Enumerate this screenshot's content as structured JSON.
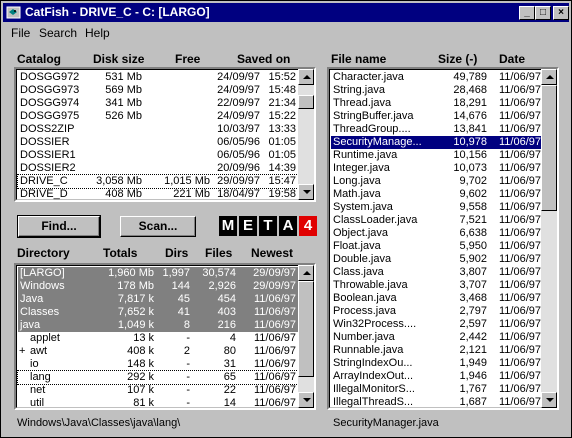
{
  "window": {
    "title": "CatFish - DRIVE_C - C: [LARGO]",
    "buttons": {
      "minimize": "_",
      "maximize": "□",
      "close": "×"
    }
  },
  "menubar": [
    "File",
    "Search",
    "Help"
  ],
  "catalog": {
    "headers": {
      "catalog": "Catalog",
      "disk_size": "Disk size",
      "free": "Free",
      "saved_on": "Saved on"
    },
    "rows": [
      {
        "name": "DOSGG972",
        "size": "531 Mb",
        "free": "",
        "date": "24/09/97",
        "time": "15:52"
      },
      {
        "name": "DOSGG973",
        "size": "569 Mb",
        "free": "",
        "date": "24/09/97",
        "time": "15:48"
      },
      {
        "name": "DOSGG974",
        "size": "341 Mb",
        "free": "",
        "date": "22/09/97",
        "time": "21:34"
      },
      {
        "name": "DOSGG975",
        "size": "526 Mb",
        "free": "",
        "date": "24/09/97",
        "time": "15:22"
      },
      {
        "name": "DOSS2ZIP",
        "size": "",
        "free": "",
        "date": "10/03/97",
        "time": "13:33"
      },
      {
        "name": "DOSSIER",
        "size": "",
        "free": "",
        "date": "06/05/96",
        "time": "01:05"
      },
      {
        "name": "DOSSIER1",
        "size": "",
        "free": "",
        "date": "06/05/96",
        "time": "01:05"
      },
      {
        "name": "DOSSIER2",
        "size": "",
        "free": "",
        "date": "20/09/96",
        "time": "14:39"
      },
      {
        "name": "DRIVE_C",
        "size": "3,058 Mb",
        "free": "1,015 Mb",
        "date": "29/09/97",
        "time": "15:47"
      },
      {
        "name": "DRIVE_D",
        "size": "408 Mb",
        "free": "221 Mb",
        "date": "18/04/97",
        "time": "19:58"
      }
    ],
    "focused_index": 8
  },
  "buttons": {
    "find": "Find...",
    "scan": "Scan..."
  },
  "logo": [
    "M",
    "E",
    "T",
    "A",
    "4"
  ],
  "directory": {
    "headers": {
      "directory": "Directory",
      "totals": "Totals",
      "dirs": "Dirs",
      "files": "Files",
      "newest": "Newest"
    },
    "rows": [
      {
        "name": "[LARGO]",
        "indent": 0,
        "prefix": "",
        "totals": "1,960 Mb",
        "dirs": "1,997",
        "files": "30,574",
        "newest": "29/09/97",
        "selected": true
      },
      {
        "name": "Windows",
        "indent": 0,
        "prefix": "",
        "totals": "178 Mb",
        "dirs": "144",
        "files": "2,926",
        "newest": "29/09/97",
        "selected": true
      },
      {
        "name": "Java",
        "indent": 0,
        "prefix": "",
        "totals": "7,817 k",
        "dirs": "45",
        "files": "454",
        "newest": "11/06/97",
        "selected": true
      },
      {
        "name": "Classes",
        "indent": 0,
        "prefix": "",
        "totals": "7,652 k",
        "dirs": "41",
        "files": "403",
        "newest": "11/06/97",
        "selected": true
      },
      {
        "name": "java",
        "indent": 0,
        "prefix": "",
        "totals": "1,049 k",
        "dirs": "8",
        "files": "216",
        "newest": "11/06/97",
        "selected": true
      },
      {
        "name": "applet",
        "indent": 1,
        "prefix": "",
        "totals": "13 k",
        "dirs": "-",
        "files": "4",
        "newest": "11/06/97",
        "selected": false
      },
      {
        "name": "awt",
        "indent": 1,
        "prefix": "+",
        "totals": "408 k",
        "dirs": "2",
        "files": "80",
        "newest": "11/06/97",
        "selected": false
      },
      {
        "name": "io",
        "indent": 1,
        "prefix": "",
        "totals": "148 k",
        "dirs": "-",
        "files": "31",
        "newest": "11/06/97",
        "selected": false
      },
      {
        "name": "lang",
        "indent": 1,
        "prefix": "",
        "totals": "292 k",
        "dirs": "-",
        "files": "65",
        "newest": "11/06/97",
        "selected": false
      },
      {
        "name": "net",
        "indent": 1,
        "prefix": "",
        "totals": "107 k",
        "dirs": "-",
        "files": "22",
        "newest": "11/06/97",
        "selected": false
      },
      {
        "name": "util",
        "indent": 1,
        "prefix": "",
        "totals": "81 k",
        "dirs": "-",
        "files": "14",
        "newest": "11/06/97",
        "selected": false
      }
    ],
    "focused_index": 8
  },
  "files": {
    "headers": {
      "name": "File name",
      "size": "Size (-)",
      "date": "Date"
    },
    "rows": [
      {
        "name": "Character.java",
        "size": "49,789",
        "date": "11/06/97"
      },
      {
        "name": "String.java",
        "size": "28,468",
        "date": "11/06/97"
      },
      {
        "name": "Thread.java",
        "size": "18,291",
        "date": "11/06/97"
      },
      {
        "name": "StringBuffer.java",
        "size": "14,676",
        "date": "11/06/97"
      },
      {
        "name": "ThreadGroup....",
        "size": "13,841",
        "date": "11/06/97"
      },
      {
        "name": "SecurityManage...",
        "size": "10,978",
        "date": "11/06/97"
      },
      {
        "name": "Runtime.java",
        "size": "10,156",
        "date": "11/06/97"
      },
      {
        "name": "Integer.java",
        "size": "10,073",
        "date": "11/06/97"
      },
      {
        "name": "Long.java",
        "size": "9,702",
        "date": "11/06/97"
      },
      {
        "name": "Math.java",
        "size": "9,602",
        "date": "11/06/97"
      },
      {
        "name": "System.java",
        "size": "9,558",
        "date": "11/06/97"
      },
      {
        "name": "ClassLoader.java",
        "size": "7,521",
        "date": "11/06/97"
      },
      {
        "name": "Object.java",
        "size": "6,638",
        "date": "11/06/97"
      },
      {
        "name": "Float.java",
        "size": "5,950",
        "date": "11/06/97"
      },
      {
        "name": "Double.java",
        "size": "5,902",
        "date": "11/06/97"
      },
      {
        "name": "Class.java",
        "size": "3,807",
        "date": "11/06/97"
      },
      {
        "name": "Throwable.java",
        "size": "3,707",
        "date": "11/06/97"
      },
      {
        "name": "Boolean.java",
        "size": "3,468",
        "date": "11/06/97"
      },
      {
        "name": "Process.java",
        "size": "2,797",
        "date": "11/06/97"
      },
      {
        "name": "Win32Process....",
        "size": "2,597",
        "date": "11/06/97"
      },
      {
        "name": "Number.java",
        "size": "2,442",
        "date": "11/06/97"
      },
      {
        "name": "Runnable.java",
        "size": "2,121",
        "date": "11/06/97"
      },
      {
        "name": "StringIndexOu...",
        "size": "1,949",
        "date": "11/06/97"
      },
      {
        "name": "ArrayIndexOut...",
        "size": "1,946",
        "date": "11/06/97"
      },
      {
        "name": "IllegalMonitorS...",
        "size": "1,767",
        "date": "11/06/97"
      },
      {
        "name": "IllegalThreadS...",
        "size": "1,687",
        "date": "11/06/97"
      }
    ],
    "selected_index": 5
  },
  "status": {
    "path": "Windows\\Java\\Classes\\java\\lang\\",
    "selected_file": "SecurityManager.java"
  },
  "colors": {
    "title_bar": "#000080",
    "selection": "#000080",
    "tree_selected": "#808080"
  }
}
